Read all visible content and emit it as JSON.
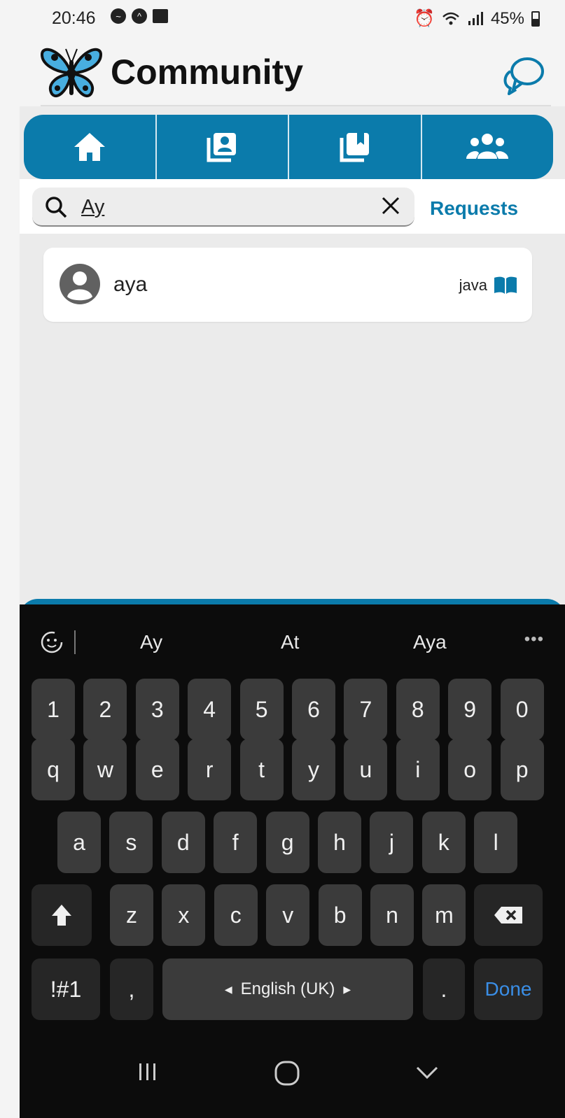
{
  "status_bar": {
    "time": "20:46",
    "battery": "45%"
  },
  "app": {
    "title": "Community"
  },
  "tabs": [
    {
      "name": "home",
      "icon": "home-icon"
    },
    {
      "name": "contacts",
      "icon": "contact-book-icon"
    },
    {
      "name": "bookmarks",
      "icon": "bookmark-icon"
    },
    {
      "name": "community",
      "icon": "group-icon"
    }
  ],
  "search": {
    "value": "Ay",
    "requests_label": "Requests"
  },
  "results": [
    {
      "name": "aya",
      "course": "java"
    }
  ],
  "keyboard": {
    "suggestions": [
      "Ay",
      "At",
      "Aya"
    ],
    "number_row": [
      "1",
      "2",
      "3",
      "4",
      "5",
      "6",
      "7",
      "8",
      "9",
      "0"
    ],
    "row1": [
      "q",
      "w",
      "e",
      "r",
      "t",
      "y",
      "u",
      "i",
      "o",
      "p"
    ],
    "row2": [
      "a",
      "s",
      "d",
      "f",
      "g",
      "h",
      "j",
      "k",
      "l"
    ],
    "row3": [
      "z",
      "x",
      "c",
      "v",
      "b",
      "n",
      "m"
    ],
    "symbols_label": "!#1",
    "comma": ",",
    "space_label": "English (UK)",
    "period": ".",
    "done_label": "Done"
  },
  "colors": {
    "brand": "#0b7bab",
    "keyboard_bg": "#0c0c0c",
    "key_bg": "#3b3b3b"
  }
}
